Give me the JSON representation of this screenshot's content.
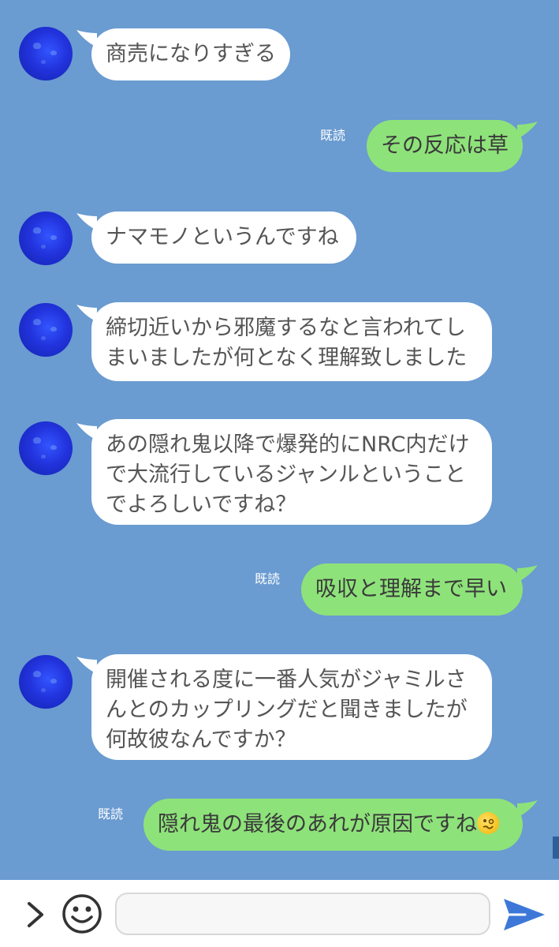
{
  "conversation": {
    "read_label": "既読",
    "messages": [
      {
        "side": "in",
        "lines": [
          "商売になりすぎる"
        ]
      },
      {
        "side": "out",
        "lines": [
          "その反応は草"
        ]
      },
      {
        "side": "in",
        "lines": [
          "ナマモノというんですね"
        ]
      },
      {
        "side": "in",
        "lines": [
          "締切近いから邪魔するなと言われてし",
          "まいましたが何となく理解致しました"
        ]
      },
      {
        "side": "in",
        "lines": [
          "あの隠れ鬼以降で爆発的にNRC内だけ",
          "で大流行しているジャンルということ",
          "でよろしいですね？"
        ]
      },
      {
        "side": "out",
        "lines": [
          "吸収と理解まで早い"
        ]
      },
      {
        "side": "in",
        "lines": [
          "開催される度に一番人気がジャミルさ",
          "んとのカップリングだと聞きましたが",
          "何故彼なんですか？"
        ]
      },
      {
        "side": "out",
        "lines": [
          "隠れ鬼の最後のあれが原因ですね"
        ],
        "emoji": "woozy-face-emoji"
      }
    ]
  },
  "inputbar": {
    "expand_icon": "chevron-right-icon",
    "sticker_icon": "smiley-icon",
    "message_value": "",
    "message_placeholder": "",
    "send_icon": "send-arrow-icon"
  },
  "colors": {
    "background": "#6a9bd1",
    "incoming_bubble": "#ffffff",
    "outgoing_bubble": "#8ee27a",
    "send_icon": "#3d78d8"
  }
}
